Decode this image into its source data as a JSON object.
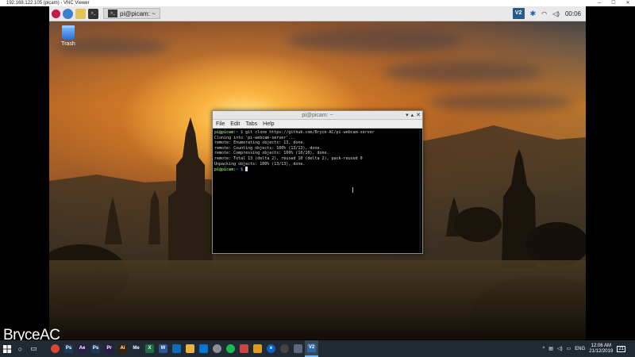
{
  "vnc_window": {
    "title": "192.168.122.105 (picam) - VNC Viewer",
    "minimize": "─",
    "maximize": "☐",
    "close": "✕"
  },
  "pi_panel": {
    "taskbar_item_label": "pi@picam: ~",
    "clock": "00:06",
    "vnc_tray_label": "V2"
  },
  "desktop": {
    "trash_label": "Trash"
  },
  "terminal": {
    "title": "pi@picam: ~",
    "menu": [
      "File",
      "Edit",
      "Tabs",
      "Help"
    ],
    "lines": [
      {
        "prompt": "pi@picam",
        "path": ":~ $ ",
        "text": "git clone https://github.com/Bryce-AC/pi-webcam-server"
      },
      {
        "text": "Cloning into 'pi-webcam-server'..."
      },
      {
        "text": "remote: Enumerating objects: 13, done."
      },
      {
        "text": "remote: Counting objects: 100% (13/13), done."
      },
      {
        "text": "remote: Compressing objects: 100% (10/10), done."
      },
      {
        "text": "remote: Total 13 (delta 2), reused 10 (delta 2), pack-reused 0"
      },
      {
        "text": "Unpacking objects: 100% (13/13), done."
      },
      {
        "prompt": "pi@picam",
        "path": ":~ $ ",
        "text": ""
      }
    ]
  },
  "watermark": "BryceAC",
  "windows_taskbar": {
    "language": "ENG",
    "time": "12:06 AM",
    "date": "21/12/2019",
    "notification_count": "21",
    "pinned_apps": [
      {
        "name": "chrome",
        "label": "",
        "color": "#db4437"
      },
      {
        "name": "photoshop",
        "label": "Ps",
        "color": "#1c3b5a"
      },
      {
        "name": "after-effects",
        "label": "Ae",
        "color": "#2a1a4a"
      },
      {
        "name": "photoshop-2",
        "label": "Ps",
        "color": "#1c3b5a"
      },
      {
        "name": "premiere",
        "label": "Pr",
        "color": "#2a1a4a"
      },
      {
        "name": "illustrator",
        "label": "Ai",
        "color": "#3a2200"
      },
      {
        "name": "media-encoder",
        "label": "Me",
        "color": "#1a2a3a"
      },
      {
        "name": "excel",
        "label": "X",
        "color": "#1d6f42"
      },
      {
        "name": "word",
        "label": "W",
        "color": "#2b579a"
      },
      {
        "name": "photos",
        "label": "",
        "color": "#0f6cbd"
      },
      {
        "name": "explorer",
        "label": "",
        "color": "#e8b23c"
      },
      {
        "name": "store",
        "label": "",
        "color": "#0078d4"
      },
      {
        "name": "steam",
        "label": "",
        "color": "#8a8f95"
      },
      {
        "name": "spotify",
        "label": "",
        "color": "#1db954"
      },
      {
        "name": "davinci",
        "label": "",
        "color": "#c44"
      },
      {
        "name": "layers-app",
        "label": "",
        "color": "#e09a1c"
      },
      {
        "name": "edge",
        "label": "e",
        "color": "#0a62c9"
      },
      {
        "name": "obs",
        "label": "",
        "color": "#444"
      },
      {
        "name": "settings",
        "label": "",
        "color": "#5a6a7a"
      },
      {
        "name": "vnc-viewer",
        "label": "V2",
        "color": "#2a6ab0"
      }
    ]
  }
}
